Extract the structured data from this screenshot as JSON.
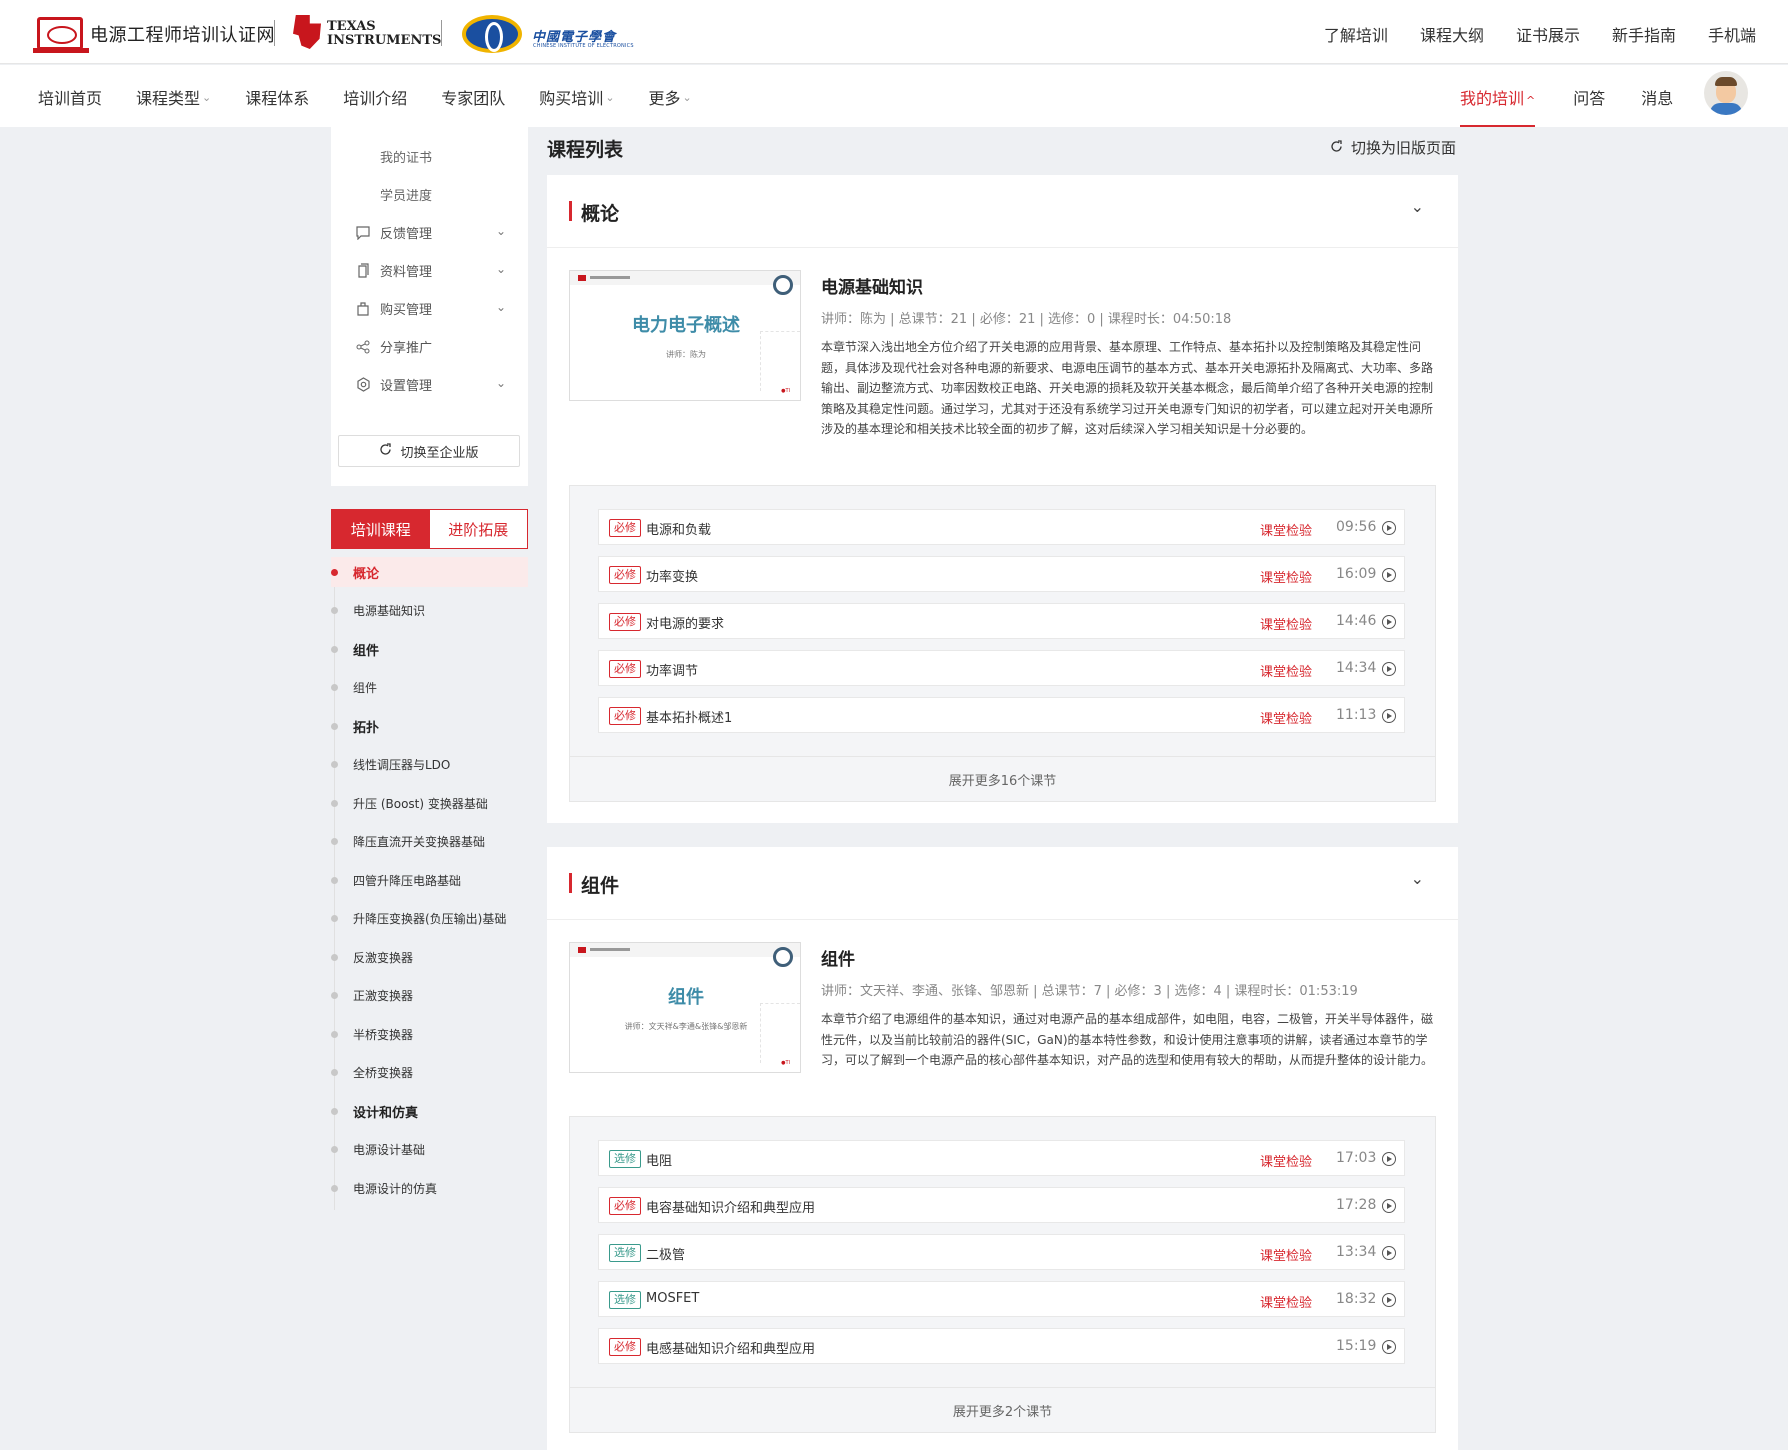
{
  "header": {
    "site_name": "电源工程师培训认证网",
    "ti_logo": "TEXAS INSTRUMENTS",
    "cie_logo": "中國電子學會",
    "cie_logo_sub": "CHINESE INSTITUTE OF ELECTRONICS",
    "top_links": [
      "了解培训",
      "课程大纲",
      "证书展示",
      "新手指南",
      "手机端"
    ]
  },
  "nav": {
    "items": [
      {
        "label": "培训首页",
        "caret": ""
      },
      {
        "label": "课程类型",
        "caret": "⌄"
      },
      {
        "label": "课程体系",
        "caret": ""
      },
      {
        "label": "培训介绍",
        "caret": ""
      },
      {
        "label": "专家团队",
        "caret": ""
      },
      {
        "label": "购买培训",
        "caret": "⌄"
      },
      {
        "label": "更多",
        "caret": "⌄"
      }
    ],
    "my_training": "我的培训",
    "my_training_caret": "^",
    "qa": "问答",
    "messages": "消息"
  },
  "sidebar": {
    "sub_items": [
      "我的证书",
      "学员进度"
    ],
    "menu": [
      {
        "label": "反馈管理",
        "icon": "chat-icon"
      },
      {
        "label": "资料管理",
        "icon": "document-icon"
      },
      {
        "label": "购买管理",
        "icon": "bag-icon"
      },
      {
        "label": "分享推广",
        "icon": "share-icon"
      },
      {
        "label": "设置管理",
        "icon": "settings-icon"
      }
    ],
    "switch_enterprise": "切换至企业版"
  },
  "tabs": {
    "training": "培训课程",
    "advanced": "进阶拓展"
  },
  "toc": [
    {
      "label": "概论",
      "section": true,
      "active": true
    },
    {
      "label": "电源基础知识",
      "section": false
    },
    {
      "label": "组件",
      "section": true
    },
    {
      "label": "组件",
      "section": false
    },
    {
      "label": "拓扑",
      "section": true
    },
    {
      "label": "线性调压器与LDO",
      "section": false
    },
    {
      "label": "升压 (Boost) 变换器基础",
      "section": false
    },
    {
      "label": "降压直流开关变换器基础",
      "section": false
    },
    {
      "label": "四管升降压电路基础",
      "section": false
    },
    {
      "label": "升降压变换器(负压输出)基础",
      "section": false
    },
    {
      "label": "反激变换器",
      "section": false
    },
    {
      "label": "正激变换器",
      "section": false
    },
    {
      "label": "半桥变换器",
      "section": false
    },
    {
      "label": "全桥变换器",
      "section": false
    },
    {
      "label": "设计和仿真",
      "section": true
    },
    {
      "label": "电源设计基础",
      "section": false
    },
    {
      "label": "电源设计的仿真",
      "section": false
    }
  ],
  "main": {
    "list_title": "课程列表",
    "switch_old": "切换为旧版页面",
    "sections": [
      {
        "title": "概论",
        "thumb_title": "电力电子概述",
        "thumb_lecturer": "讲师：陈为",
        "course_title": "电源基础知识",
        "meta": "讲师：陈为  |  总课节：21  |  必修：21  |  选修：0  |  课程时长：04:50:18",
        "description": "本章节深入浅出地全方位介绍了开关电源的应用背景、基本原理、工作特点、基本拓扑以及控制策略及其稳定性问题，具体涉及现代社会对各种电源的新要求、电源电压调节的基本方式、基本开关电源拓扑及隔离式、大功率、多路输出、副边整流方式、功率因数校正电路、开关电源的损耗及软开关基本概念，最后简单介绍了各种开关电源的控制策略及其稳定性问题。通过学习，尤其对于还没有系统学习过开关电源专门知识的初学者，可以建立起对开关电源所涉及的基本理论和相关技术比较全面的初步了解，这对后续深入学习相关知识是十分必要的。",
        "lessons": [
          {
            "tag": "必修",
            "type": "req",
            "name": "电源和负载",
            "quiz": "课堂检验",
            "duration": "09:56"
          },
          {
            "tag": "必修",
            "type": "req",
            "name": "功率变换",
            "quiz": "课堂检验",
            "duration": "16:09"
          },
          {
            "tag": "必修",
            "type": "req",
            "name": "对电源的要求",
            "quiz": "课堂检验",
            "duration": "14:46"
          },
          {
            "tag": "必修",
            "type": "req",
            "name": "功率调节",
            "quiz": "课堂检验",
            "duration": "14:34"
          },
          {
            "tag": "必修",
            "type": "req",
            "name": "基本拓扑概述1",
            "quiz": "课堂检验",
            "duration": "11:13"
          }
        ],
        "more": "展开更多16个课节"
      },
      {
        "title": "组件",
        "thumb_title": "组件",
        "thumb_lecturer": "讲师：文天祥&李通&张锋&邹恩新",
        "course_title": "组件",
        "meta": "讲师：文天祥、李通、张锋、邹恩新  |  总课节：7  |  必修：3  |  选修：4  |  课程时长：01:53:19",
        "description": "本章节介绍了电源组件的基本知识，通过对电源产品的基本组成部件，如电阻，电容，二极管，开关半导体器件，磁性元件，以及当前比较前沿的器件(SIC，GaN)的基本特性参数，和设计使用注意事项的讲解，读者通过本章节的学习，可以了解到一个电源产品的核心部件基本知识，对产品的选型和使用有较大的帮助，从而提升整体的设计能力。",
        "lessons": [
          {
            "tag": "选修",
            "type": "opt",
            "name": "电阻",
            "quiz": "课堂检验",
            "duration": "17:03"
          },
          {
            "tag": "必修",
            "type": "req",
            "name": "电容基础知识介绍和典型应用",
            "quiz": "",
            "duration": "17:28"
          },
          {
            "tag": "选修",
            "type": "opt",
            "name": "二极管",
            "quiz": "课堂检验",
            "duration": "13:34"
          },
          {
            "tag": "选修",
            "type": "opt",
            "name": "MOSFET",
            "quiz": "课堂检验",
            "duration": "18:32"
          },
          {
            "tag": "必修",
            "type": "req",
            "name": "电感基础知识介绍和典型应用",
            "quiz": "",
            "duration": "15:19"
          }
        ],
        "more": "展开更多2个课节"
      }
    ]
  },
  "colors": {
    "accent": "#d7282f",
    "optional": "#3a9a8c",
    "background": "#eef0f3"
  }
}
